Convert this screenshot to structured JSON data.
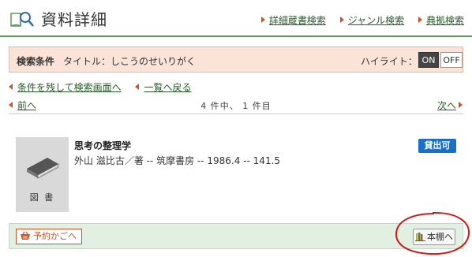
{
  "header": {
    "title": "資料詳細",
    "links": [
      "詳細蔵書検索",
      "ジャンル検索",
      "典拠検索"
    ]
  },
  "condition": {
    "label": "検索条件",
    "text": "タイトル：しこうのせいりがく",
    "highlight_label": "ハイライト：",
    "toggle_on": "ON",
    "toggle_off": "OFF"
  },
  "nav": {
    "back_to_search": "条件を残して検索画面へ",
    "back_to_list": "一覧へ戻る",
    "prev": "前へ",
    "next": "次へ",
    "count": "4 件中、 1 件目"
  },
  "record": {
    "material_type": "図 書",
    "title": "思考の整理学",
    "meta": "外山 滋比古／著 -- 筑摩書房 -- 1986.4 -- 141.5",
    "status": "貸出可"
  },
  "actions": {
    "reserve": "予約かごへ",
    "shelf": "本棚へ"
  },
  "colors": {
    "accent_green": "#5a9a5a",
    "link_arrow": "#c9562a",
    "status_blue": "#1a6fc9",
    "annotation_red": "#d11a1a"
  },
  "icons": {
    "header": "book-search-icon",
    "thumbnail": "book-icon",
    "reserve": "basket-icon",
    "shelf": "shelf-icon"
  }
}
